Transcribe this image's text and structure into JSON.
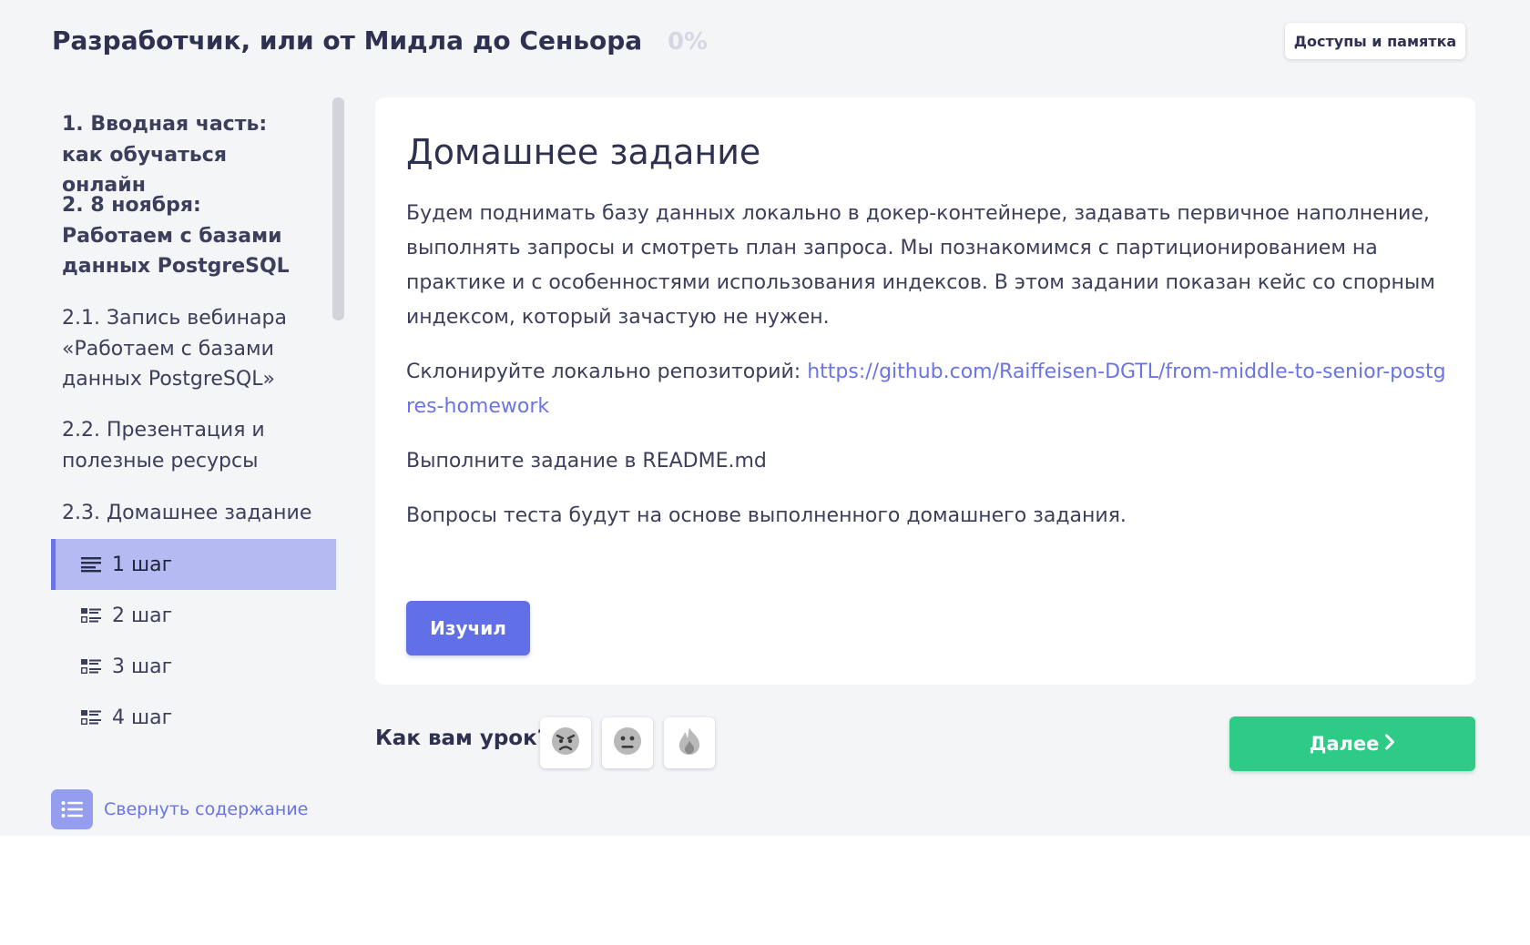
{
  "header": {
    "course_title": "Разработчик, или от Мидла до Сеньора",
    "progress": "0%",
    "access_button": "Доступы и памятка"
  },
  "sidebar": {
    "items": [
      {
        "label": "1. Вводная часть: как обучаться онлайн"
      },
      {
        "label": "2. 8 ноября: Работаем с базами данных PostgreSQL"
      },
      {
        "label": "2.1. Запись вебинара «Работаем с базами данных PostgreSQL»"
      },
      {
        "label": "2.2. Презентация и полезные ресурсы"
      },
      {
        "label": "2.3. Домашнее задание"
      }
    ],
    "steps": [
      {
        "label": "1 шаг",
        "icon": "text-lines-icon",
        "active": true
      },
      {
        "label": "2 шаг",
        "icon": "checklist-icon"
      },
      {
        "label": "3 шаг",
        "icon": "checklist-icon"
      },
      {
        "label": "4 шаг",
        "icon": "checklist-icon"
      }
    ],
    "collapse_label": "Свернуть содержание"
  },
  "lesson": {
    "title": "Домашнее задание",
    "paragraph1": "Будем поднимать базу данных локально в докер-контейнере, задавать первичное наполнение, выполнять запросы и смотреть план запроса. Мы познакомимся с партиционированием на практике и с особенностями использования индексов. В этом задании показан кейс со спорным индексом, который зачастую не нужен.",
    "paragraph2_prefix": "Склонируйте локально репозиторий: ",
    "repo_link": "https://github.com/Raiffeisen-DGTL/from-middle-to-senior-postgres-homework",
    "paragraph3": "Выполните задание в README.md",
    "paragraph4": "Вопросы теста будут на основе выполненного домашнего задания.",
    "done_button": "Изучил"
  },
  "feedback": {
    "question": "Как вам урок?",
    "options": [
      "angry-face-icon",
      "neutral-face-icon",
      "fire-icon"
    ]
  },
  "navigation": {
    "next_button": "Далее"
  },
  "colors": {
    "accent": "#6170e6",
    "active_step_bg": "#b4bbf2",
    "next_button": "#2ecb86",
    "page_bg": "#f4f5f7"
  }
}
